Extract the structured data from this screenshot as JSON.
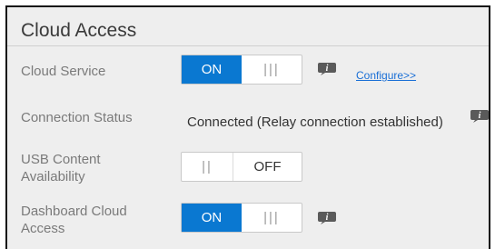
{
  "panel": {
    "title": "Cloud Access"
  },
  "rows": {
    "cloud_service": {
      "label": "Cloud Service",
      "toggle_on_label": "ON",
      "toggle_off_grip": "|||",
      "link": "Configure>>"
    },
    "connection_status": {
      "label": "Connection Status",
      "value": "Connected (Relay connection established)"
    },
    "usb_content": {
      "label_line1": "USB Content",
      "label_line2": "Availability",
      "toggle_on_grip": "||",
      "toggle_off_label": "OFF"
    },
    "dashboard_cloud": {
      "label_line1": "Dashboard Cloud",
      "label_line2": "Access",
      "toggle_on_label": "ON",
      "toggle_off_grip": "|||"
    }
  },
  "colors": {
    "accent": "#0a78d1",
    "link": "#1a6fd6",
    "panel_bg": "#eeeeee"
  },
  "icons": {
    "info": "info-icon"
  }
}
